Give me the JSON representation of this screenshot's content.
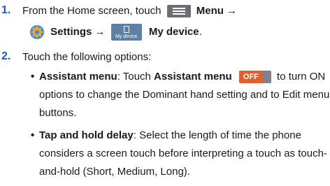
{
  "steps": [
    {
      "number": "1.",
      "line1_prefix": "From the Home screen, touch",
      "menu_label": "Menu",
      "arrow1": "→",
      "settings_label": "Settings",
      "arrow2": "→",
      "icon_caption": "My device",
      "mydevice_label": "My device",
      "end_period": "."
    },
    {
      "number": "2.",
      "text": "Touch the following options:"
    }
  ],
  "bullets": [
    {
      "marker": "•",
      "term": "Assistant menu",
      "colon": ":",
      "touch_word": "Touch",
      "term2": "Assistant menu",
      "toggle_label": "OFF",
      "line1_suffix": "to turn ON",
      "line2": "options to change the Dominant hand setting and to Edit menu",
      "line3": "buttons."
    },
    {
      "marker": "•",
      "term": "Tap and hold delay",
      "colon": ":",
      "line1_suffix": "Select the length of time the phone",
      "line2": "considers a screen touch before interpreting a touch as touch-",
      "line3": "and-hold (Short, Medium, Long)."
    }
  ],
  "colors": {
    "step_number": "#1b5fb0",
    "toggle_off": "#e0612d",
    "icon_background": "#5e7fa6"
  }
}
